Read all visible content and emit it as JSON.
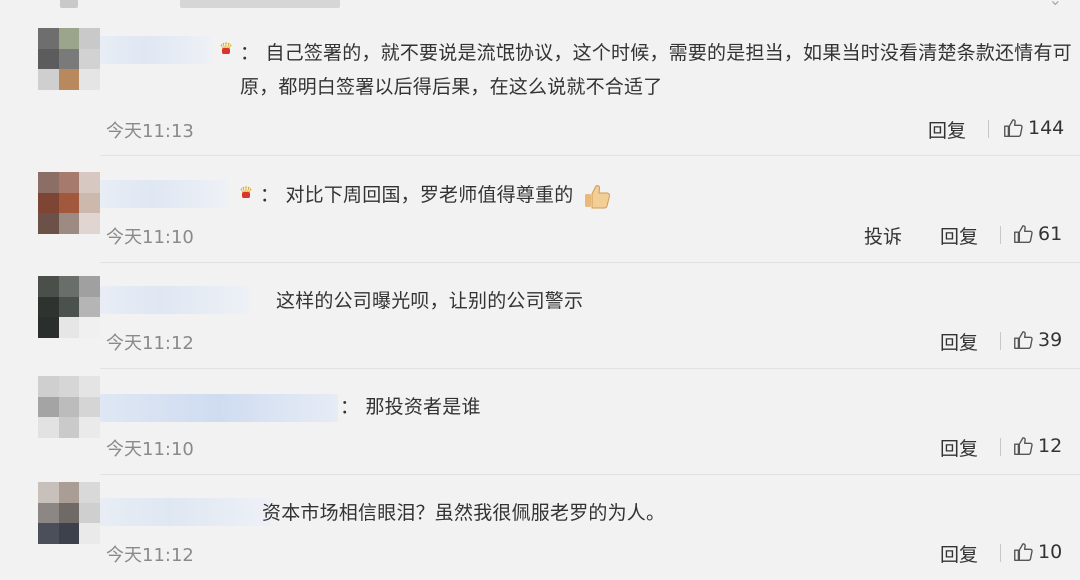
{
  "top": {
    "more_icon": "chevron-down-icon"
  },
  "comments": [
    {
      "has_crown": true,
      "text": "：  自己签署的，就不要说是流氓协议，这个时候，需要的是担当，如果当时没看清楚条款还情有可原，都明白签署以后得后果，在这么说就不合适了",
      "time": "今天11:13",
      "reply_label": "回复",
      "report_label": "",
      "likes": "144"
    },
    {
      "has_crown": true,
      "text": "：  对比下周回国，罗老师值得尊重的",
      "emoji": "thumbs-up-emoji",
      "time": "今天11:10",
      "reply_label": "回复",
      "report_label": "投诉",
      "likes": "61"
    },
    {
      "has_crown": false,
      "text": "这样的公司曝光呗，让别的公司警示",
      "time": "今天11:12",
      "reply_label": "回复",
      "report_label": "",
      "likes": "39"
    },
    {
      "has_crown": false,
      "text": "：  那投资者是谁",
      "time": "今天11:10",
      "reply_label": "回复",
      "report_label": "",
      "likes": "12"
    },
    {
      "has_crown": false,
      "text": "资本市场相信眼泪？虽然我很佩服老罗的为人。",
      "time": "今天11:12",
      "reply_label": "回复",
      "report_label": "",
      "likes": "10"
    }
  ],
  "colors": {
    "background": "#f2f2f2",
    "text": "#333333",
    "time": "#8a8a8a"
  }
}
